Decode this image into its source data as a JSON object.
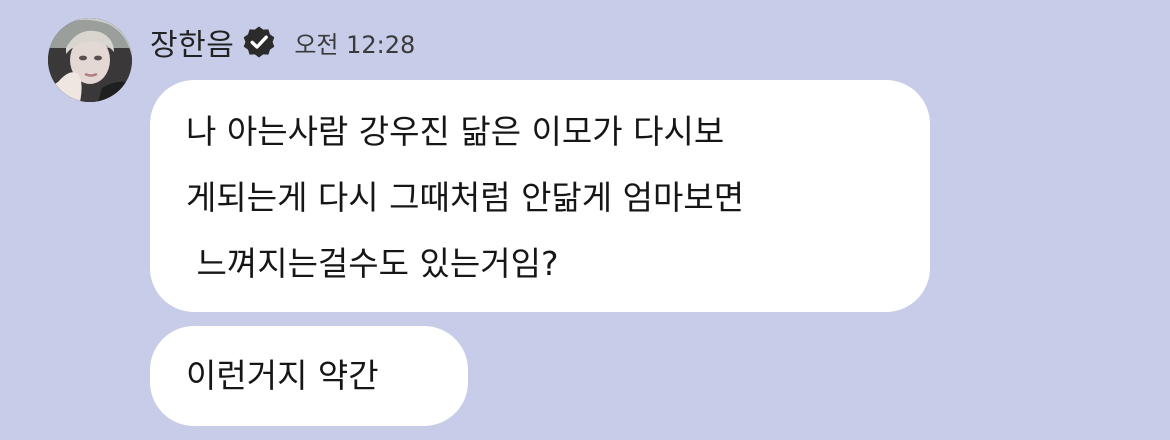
{
  "message_group": {
    "sender": {
      "name": "장한음",
      "verified": true,
      "avatar_icon": "profile-photo"
    },
    "timestamp": "오전 12:28",
    "messages": [
      {
        "lines": [
          "나 아는사람 강우진 닮은 이모가 다시보",
          "게되는게 다시 그때처럼 안닮게 엄마보면",
          " 느껴지는걸수도 있는거임?"
        ]
      },
      {
        "lines": [
          "이런거지 약간"
        ]
      }
    ]
  },
  "colors": {
    "background": "#c7cde8",
    "bubble": "#ffffff",
    "text": "#161616",
    "verified_badge": "#2b2b2b"
  }
}
